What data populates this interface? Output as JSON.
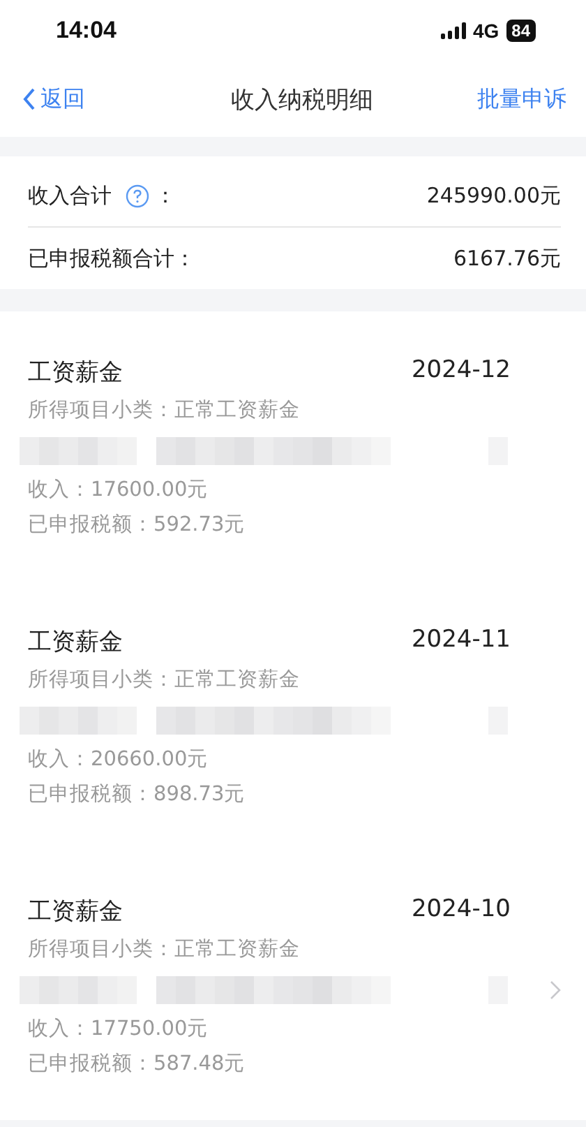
{
  "status_bar": {
    "time": "14:04",
    "network": "4G",
    "battery": "84"
  },
  "nav": {
    "back": "返回",
    "title": "收入纳税明细",
    "action": "批量申诉"
  },
  "summary": [
    {
      "label": "收入合计",
      "help": true,
      "colon": "：",
      "value": "245990.00元"
    },
    {
      "label": "已申报税额合计：",
      "help": false,
      "value": "6167.76元"
    }
  ],
  "records": [
    {
      "title": "工资薪金",
      "period": "2024-12",
      "subtype": "所得项目小类：正常工资薪金",
      "income": "收入：17600.00元",
      "tax": "已申报税额：592.73元",
      "arrow": false
    },
    {
      "title": "工资薪金",
      "period": "2024-11",
      "subtype": "所得项目小类：正常工资薪金",
      "income": "收入：20660.00元",
      "tax": "已申报税额：898.73元",
      "arrow": false
    },
    {
      "title": "工资薪金",
      "period": "2024-10",
      "subtype": "所得项目小类：正常工资薪金",
      "income": "收入：17750.00元",
      "tax": "已申报税额：587.48元",
      "arrow": true
    }
  ]
}
